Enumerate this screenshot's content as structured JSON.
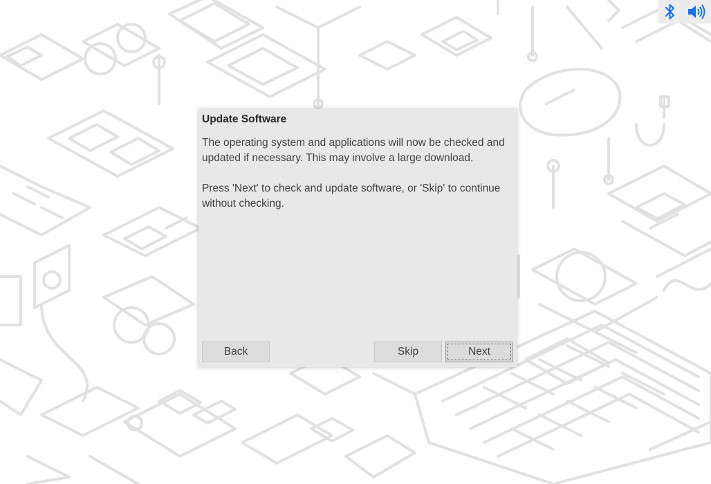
{
  "tray": {
    "icons": [
      "bluetooth-icon",
      "volume-icon"
    ],
    "accent_color": "#1a73e8"
  },
  "dialog": {
    "title": "Update Software",
    "paragraph1": "The operating system and applications will now be checked and updated if necessary. This may involve a large download.",
    "paragraph2": "Press 'Next' to check and update software, or 'Skip' to continue without checking.",
    "back_label": "Back",
    "skip_label": "Skip",
    "next_label": "Next"
  }
}
